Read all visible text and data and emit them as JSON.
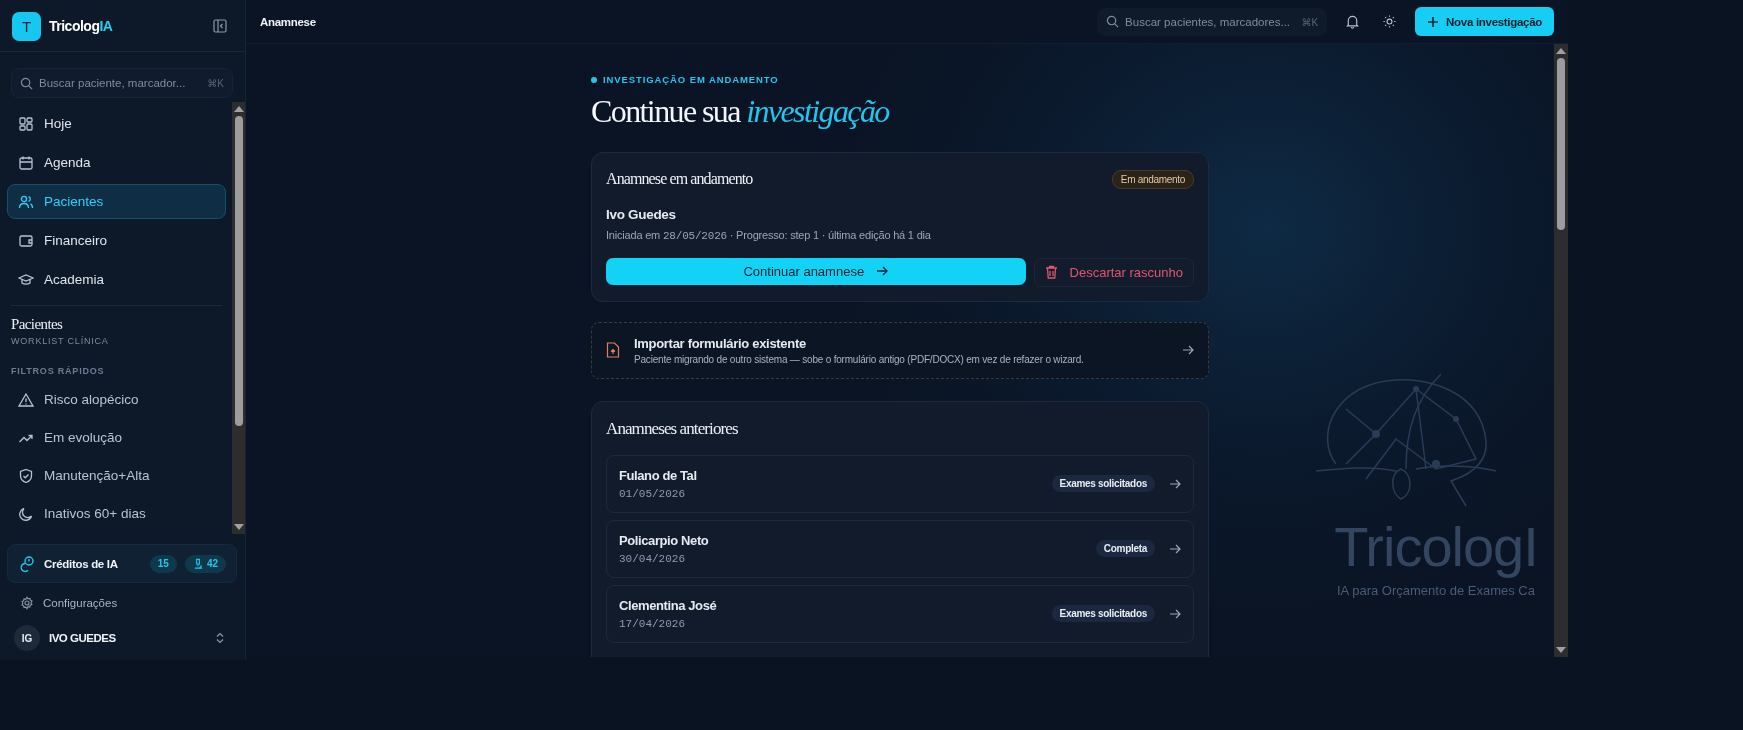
{
  "sidebar": {
    "brand": {
      "initial": "T",
      "name": "Tricolog",
      "name_accent": "IA"
    },
    "search": {
      "placeholder": "Buscar paciente, marcador...",
      "shortcut": "⌘K"
    },
    "nav": [
      {
        "label": "Hoje",
        "selected": false
      },
      {
        "label": "Agenda",
        "selected": false
      },
      {
        "label": "Pacientes",
        "selected": true
      },
      {
        "label": "Financeiro",
        "selected": false
      },
      {
        "label": "Academia",
        "selected": false
      }
    ],
    "section": {
      "title": "Pacientes",
      "subtitle": "WORKLIST CLÍNICA"
    },
    "filters_heading": "FILTROS RÁPIDOS",
    "filters": [
      {
        "label": "Risco alopécico"
      },
      {
        "label": "Em evolução"
      },
      {
        "label": "Manutenção+Alta"
      },
      {
        "label": "Inativos 60+ dias"
      }
    ],
    "credits": {
      "label": "Créditos de IA",
      "count": "15",
      "secondary_count": "42"
    },
    "settings": "Configurações",
    "user": {
      "initials": "IG",
      "name": "IVO GUEDES"
    }
  },
  "topbar": {
    "title": "Anamnese",
    "search": {
      "placeholder": "Buscar pacientes, marcadores...",
      "shortcut": "⌘K"
    },
    "new_button": "Nova investigação"
  },
  "main": {
    "overline": "INVESTIGAÇÃO EM ANDAMENTO",
    "heading": "Continue sua",
    "heading_accent": "investigação",
    "current": {
      "title": "Anamnese em andamento",
      "status": "Em andamento",
      "patient": "Ivo Guedes",
      "started_label": "Iniciada em",
      "date": "28/05/2026",
      "details": "· Progresso: step 1 · última edição há 1 dia",
      "continue_button": "Continuar anamnese",
      "discard_button": "Descartar rascunho"
    },
    "import": {
      "title": "Importar formulário existente",
      "description": "Paciente migrando de outro sistema — sobe o formulário antigo (PDF/DOCX) em vez de refazer o wizard."
    },
    "previous": {
      "title": "Anamneses anteriores",
      "items": [
        {
          "name": "Fulano de Tal",
          "date": "01/05/2026",
          "status": "Exames solicitados"
        },
        {
          "name": "Policarpio Neto",
          "date": "30/04/2026",
          "status": "Completa"
        },
        {
          "name": "Clementina José",
          "date": "17/04/2026",
          "status": "Exames solicitados"
        }
      ]
    }
  },
  "background_logo": {
    "name": "TricologI",
    "tagline": "IA para Orçamento de Exames Ca"
  }
}
